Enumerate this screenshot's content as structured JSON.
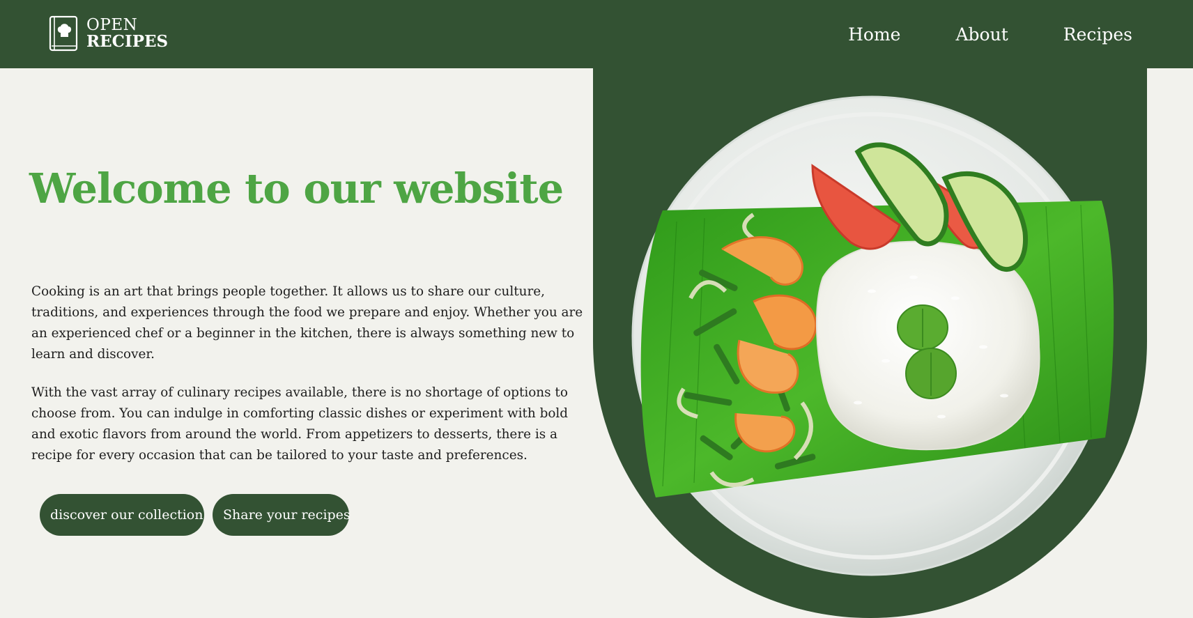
{
  "brand": {
    "line1": "OPEN",
    "line2": "RECIPES",
    "icon": "chef-hat-book-icon"
  },
  "nav": {
    "items": [
      {
        "label": "Home"
      },
      {
        "label": "About"
      },
      {
        "label": "Recipes"
      }
    ]
  },
  "hero": {
    "title": "Welcome to our website",
    "paragraphs": [
      "Cooking is an art that brings people together. It allows us to share our culture, traditions, and experiences through the food we prepare and enjoy. Whether you are an experienced chef or a beginner in the kitchen, there is always something new to learn and discover.",
      "With the vast array of culinary recipes available, there is no shortage of options to choose from. You can indulge in comforting classic dishes or experiment with bold and exotic flavors from around the world. From appetizers to desserts, there is a recipe for every occasion that can be tailored to your taste and preferences."
    ],
    "buttons": {
      "discover": "discover our collection",
      "share": "Share your recipes"
    },
    "image": "plate of rice with shrimp, green beans, tomato and cucumber on banana leaf"
  },
  "colors": {
    "primary_dark_green": "#335233",
    "accent_green": "#4ea544",
    "background": "#f2f2ed",
    "text": "#1e1e1e"
  }
}
